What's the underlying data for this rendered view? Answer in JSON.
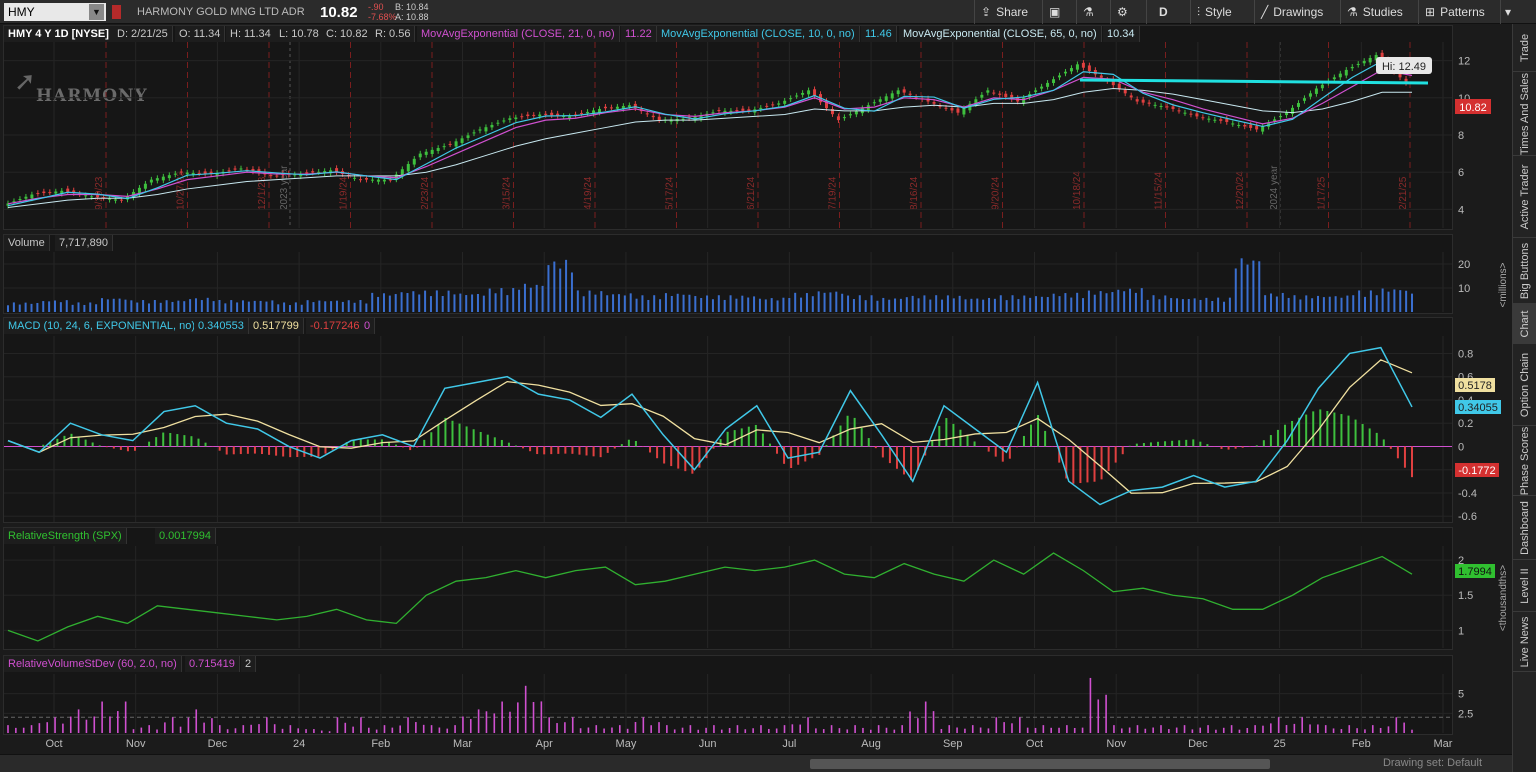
{
  "toolbar": {
    "symbol": "HMY",
    "company": "HARMONY GOLD MNG LTD ADR",
    "last": "10.82",
    "change": "-.90",
    "change_pct": "-7.68%",
    "bid": "B: 10.84",
    "ask": "A: 10.88",
    "share": "Share",
    "period": "D",
    "style": "Style",
    "drawings": "Drawings",
    "studies": "Studies",
    "patterns": "Patterns"
  },
  "sidebar": [
    "Trade",
    "Times And Sales",
    "Active Trader",
    "Big Buttons",
    "Chart",
    "Option Chain",
    "Phase Scores",
    "Dashboard",
    "Level II",
    "Live News"
  ],
  "sidebar_active": 4,
  "footer": {
    "drawing_set": "Drawing set: Default"
  },
  "logo": "HARMONY",
  "price_labels": {
    "title": "HMY 4 Y 1D [NYSE]",
    "date": "D: 2/21/25",
    "open": "O: 11.34",
    "high": "H: 11.34",
    "low": "L: 10.78",
    "close": "C: 10.82",
    "range": "R: 0.56",
    "ema21_label": "MovAvgExponential (CLOSE, 21, 0, no)",
    "ema21_val": "11.22",
    "ema10_label": "MovAvgExponential (CLOSE, 10, 0, no)",
    "ema10_val": "11.46",
    "ema65_label": "MovAvgExponential (CLOSE, 65, 0, no)",
    "ema65_val": "10.34",
    "hi_bubble": "Hi: 12.49",
    "last_tag": "10.82"
  },
  "volume_labels": {
    "title": "Volume",
    "value": "7,717,890",
    "unit": "<millions>"
  },
  "macd_labels": {
    "title": "MACD (10, 24, 6, EXPONENTIAL, no)",
    "value": "0.340553",
    "avg": "0.517799",
    "diff": "-0.177246",
    "zero": "0",
    "avg_tag": "0.5178",
    "value_tag": "0.34055",
    "diff_tag": "-0.1772"
  },
  "rs_labels": {
    "title": "RelativeStrength (SPX)",
    "value": "0.0017994",
    "unit": "<thousandths>",
    "tag": "1.7994"
  },
  "rv_labels": {
    "title": "RelativeVolumeStDev (60, 2.0, no)",
    "value": "0.715419",
    "extra": "2"
  },
  "colors": {
    "up": "#3ec03e",
    "down": "#e04040",
    "ema21": "#d050d0",
    "ema10": "#40c8e8",
    "ema65": "#c8e8f0",
    "macd": "#40c8e8",
    "avg": "#f0e0a0",
    "rs": "#30b030",
    "rv": "#d050d0",
    "trend": "#20e0e0"
  },
  "chart_data": {
    "type": "candlestick",
    "x_axis_labels": [
      "Oct",
      "Nov",
      "Dec",
      "24",
      "Feb",
      "Mar",
      "Apr",
      "May",
      "Jun",
      "Jul",
      "Aug",
      "Sep",
      "Oct",
      "Nov",
      "Dec",
      "25",
      "Feb",
      "Mar"
    ],
    "event_dates": [
      "9/29/23",
      "10/27/23",
      "12/1/23",
      "1/19/24",
      "2/23/24",
      "3/15/24",
      "4/19/24",
      "5/17/24",
      "6/21/24",
      "7/19/24",
      "8/16/24",
      "9/20/24",
      "10/18/24",
      "11/15/24",
      "12/20/24",
      "1/17/25",
      "2/21/25"
    ],
    "year_marks": [
      "2023 year",
      "2024 year"
    ],
    "price_axis": {
      "min": 3,
      "max": 13,
      "ticks": [
        4,
        6,
        8,
        10,
        12
      ]
    },
    "volume_axis": {
      "ticks": [
        10,
        20
      ]
    },
    "macd_axis": {
      "ticks": [
        -0.6,
        -0.4,
        -0.2,
        0,
        0.2,
        0.4,
        0.6,
        0.8
      ]
    },
    "rs_axis": {
      "ticks": [
        1,
        1.5,
        2
      ]
    },
    "rv_axis": {
      "ticks": [
        2.5,
        5
      ]
    },
    "price_close": [
      4.2,
      4.8,
      5.0,
      4.7,
      4.5,
      5.6,
      6.0,
      5.9,
      6.2,
      5.8,
      5.9,
      6.1,
      5.6,
      5.6,
      7.0,
      7.5,
      8.3,
      8.9,
      9.1,
      9.0,
      9.4,
      9.6,
      8.8,
      8.9,
      9.3,
      9.3,
      9.7,
      10.4,
      8.8,
      9.6,
      10.4,
      9.8,
      9.2,
      10.4,
      9.8,
      10.8,
      11.8,
      10.9,
      9.8,
      9.5,
      9.0,
      8.7,
      8.3,
      9.2,
      10.5,
      11.5,
      12.3,
      10.8
    ],
    "ema21": [
      4.3,
      4.6,
      4.8,
      4.8,
      4.7,
      5.1,
      5.6,
      5.8,
      6.0,
      5.9,
      5.9,
      6.0,
      5.8,
      5.7,
      6.3,
      7.0,
      7.7,
      8.4,
      8.8,
      8.9,
      9.2,
      9.4,
      9.1,
      9.0,
      9.2,
      9.3,
      9.5,
      10.0,
      9.4,
      9.5,
      10.0,
      9.9,
      9.5,
      10.0,
      9.9,
      10.4,
      11.1,
      11.0,
      10.3,
      9.9,
      9.4,
      9.0,
      8.6,
      8.9,
      9.7,
      10.6,
      11.5,
      11.2
    ],
    "ema65": [
      4.1,
      4.3,
      4.5,
      4.6,
      4.6,
      4.8,
      5.1,
      5.3,
      5.5,
      5.6,
      5.7,
      5.8,
      5.8,
      5.8,
      6.0,
      6.4,
      6.9,
      7.4,
      7.8,
      8.1,
      8.4,
      8.7,
      8.8,
      8.8,
      8.9,
      9.0,
      9.1,
      9.4,
      9.3,
      9.3,
      9.5,
      9.6,
      9.5,
      9.7,
      9.7,
      9.9,
      10.3,
      10.5,
      10.4,
      10.2,
      9.9,
      9.6,
      9.3,
      9.2,
      9.4,
      9.8,
      10.3,
      10.3
    ],
    "volume": [
      4,
      5,
      4,
      6,
      5,
      5,
      6,
      5,
      5,
      4,
      5,
      5,
      8,
      9,
      9,
      8,
      10,
      12,
      22,
      9,
      8,
      7,
      8,
      7,
      7,
      6,
      8,
      9,
      7,
      6,
      7,
      7,
      6,
      7,
      7,
      8,
      9,
      10,
      7,
      6,
      6,
      23,
      8,
      7,
      7,
      9,
      10,
      8
    ],
    "macd": [
      0.05,
      -0.05,
      0.2,
      0.1,
      0.05,
      0.3,
      0.35,
      0.2,
      0.15,
      0.0,
      -0.1,
      0.05,
      0.1,
      0.0,
      0.5,
      0.55,
      0.6,
      0.45,
      0.4,
      0.25,
      0.45,
      0.1,
      -0.2,
      0.15,
      0.35,
      -0.1,
      -0.05,
      0.48,
      0.1,
      -0.3,
      0.35,
      0.15,
      -0.05,
      0.55,
      -0.3,
      -0.5,
      -0.38,
      -0.35,
      -0.25,
      -0.35,
      -0.3,
      0.05,
      0.5,
      0.8,
      0.85,
      0.34
    ],
    "rs": [
      1.0,
      0.85,
      1.05,
      1.2,
      1.1,
      1.35,
      1.3,
      1.25,
      1.2,
      1.15,
      1.2,
      1.3,
      1.15,
      1.1,
      1.5,
      1.7,
      1.75,
      1.85,
      1.75,
      1.85,
      1.9,
      1.65,
      1.7,
      1.8,
      1.9,
      1.85,
      1.9,
      2.0,
      1.8,
      1.75,
      1.95,
      1.8,
      1.7,
      2.0,
      1.8,
      2.1,
      1.85,
      1.55,
      1.6,
      1.5,
      1.45,
      1.3,
      1.3,
      1.5,
      1.75,
      1.9,
      2.05,
      1.8
    ],
    "rv": [
      1,
      2,
      3,
      4,
      1,
      2,
      3,
      1,
      2,
      1,
      0.5,
      2,
      1,
      2,
      1,
      3,
      4,
      6,
      2,
      1,
      1,
      2,
      1,
      1,
      1,
      1,
      2,
      1,
      1,
      1,
      4,
      1,
      1,
      2,
      1,
      1,
      7,
      1,
      1,
      1,
      1,
      1,
      2,
      2,
      1,
      1,
      2,
      1
    ]
  }
}
